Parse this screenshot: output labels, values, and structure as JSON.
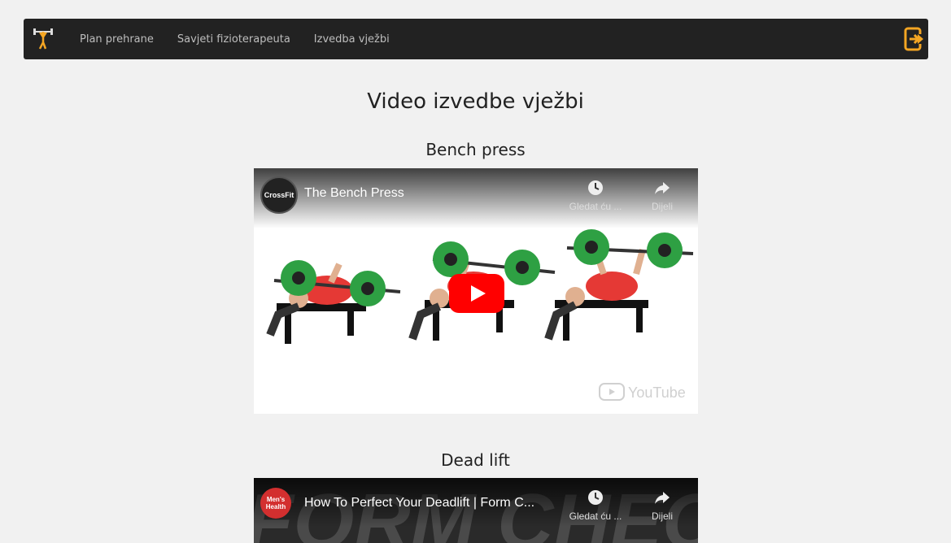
{
  "nav": {
    "links": [
      "Plan prehrane",
      "Savjeti fizioterapeuta",
      "Izvedba vježbi"
    ]
  },
  "page": {
    "title": "Video izvedbe vježbi"
  },
  "videos": [
    {
      "section_title": "Bench press",
      "channel": "CrossFit",
      "title": "The Bench Press",
      "watch_later": "Gledat ću ...",
      "share": "Dijeli",
      "watermark": "YouTube"
    },
    {
      "section_title": "Dead lift",
      "channel": "Men's Health",
      "title": "How To Perfect Your Deadlift | Form C...",
      "watch_later": "Gledat ću ...",
      "share": "Dijeli",
      "background_text": "FORM CHECK"
    }
  ],
  "colors": {
    "navbar": "#222222",
    "accent": "#f5a623",
    "play": "#ff0000",
    "plate": "#2ea043",
    "shirt": "#e53935"
  }
}
